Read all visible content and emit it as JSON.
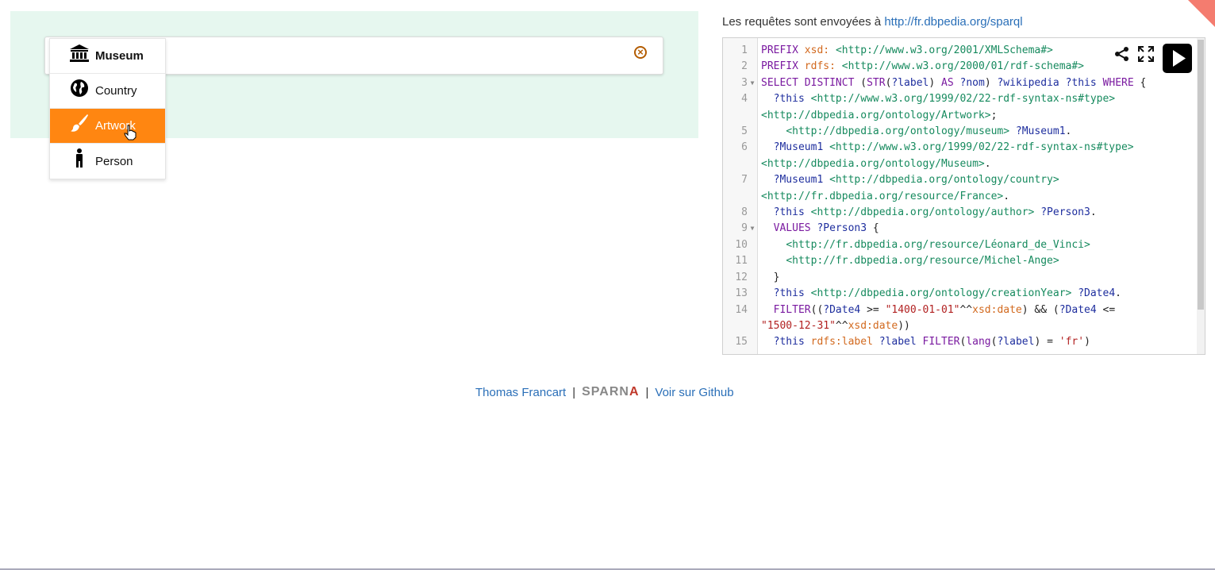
{
  "menu": {
    "items": [
      {
        "label": "Museum",
        "icon": "museum-icon"
      },
      {
        "label": "Country",
        "icon": "globe-icon"
      },
      {
        "label": "Artwork",
        "icon": "paintbrush-icon",
        "state": "hovered"
      },
      {
        "label": "Person",
        "icon": "person-icon"
      }
    ]
  },
  "endpoint": {
    "prefix": "Les requêtes sont envoyées à",
    "url": "http://fr.dbpedia.org/sparql"
  },
  "editor": {
    "lines": [
      {
        "n": "1"
      },
      {
        "n": "2"
      },
      {
        "n": "3"
      },
      {
        "n": "4"
      },
      {
        "n": ""
      },
      {
        "n": "5"
      },
      {
        "n": "6"
      },
      {
        "n": ""
      },
      {
        "n": "7"
      },
      {
        "n": ""
      },
      {
        "n": "8"
      },
      {
        "n": "9"
      },
      {
        "n": "10"
      },
      {
        "n": "11"
      },
      {
        "n": "12"
      },
      {
        "n": "13"
      },
      {
        "n": "14"
      },
      {
        "n": ""
      },
      {
        "n": "15"
      }
    ],
    "code": [
      "PREFIX xsd: <http://www.w3.org/2001/XMLSchema#>",
      "PREFIX rdfs: <http://www.w3.org/2000/01/rdf-schema#>",
      "SELECT DISTINCT (STR(?label) AS ?nom) ?wikipedia ?this WHERE {",
      "  ?this <http://www.w3.org/1999/02/22-rdf-syntax-ns#type>",
      "<http://dbpedia.org/ontology/Artwork>;",
      "    <http://dbpedia.org/ontology/museum> ?Museum1.",
      "  ?Museum1 <http://www.w3.org/1999/02/22-rdf-syntax-ns#type>",
      "<http://dbpedia.org/ontology/Museum>.",
      "  ?Museum1 <http://dbpedia.org/ontology/country>",
      "<http://fr.dbpedia.org/resource/France>.",
      "  ?this <http://dbpedia.org/ontology/author> ?Person3.",
      "  VALUES ?Person3 {",
      "    <http://fr.dbpedia.org/resource/Léonard_de_Vinci>",
      "    <http://fr.dbpedia.org/resource/Michel-Ange>",
      "  }",
      "  ?this <http://dbpedia.org/ontology/creationYear> ?Date4.",
      "  FILTER((?Date4 >= \"1400-01-01\"^^xsd:date) && (?Date4 <=",
      "\"1500-12-31\"^^xsd:date))",
      "  ?this rdfs:label ?label FILTER(lang(?label) = 'fr')"
    ],
    "toolbar": [
      "share-icon",
      "fullscreen-icon",
      "run-query-icon"
    ]
  },
  "footer": {
    "author": "Thomas Francart",
    "separator": "|",
    "logo_text": "SPARNA",
    "github": "Voir sur Github"
  },
  "colors": {
    "active": "#ff8611",
    "builder_bg": "#e6f7ef",
    "link": "#2a6fb8"
  }
}
